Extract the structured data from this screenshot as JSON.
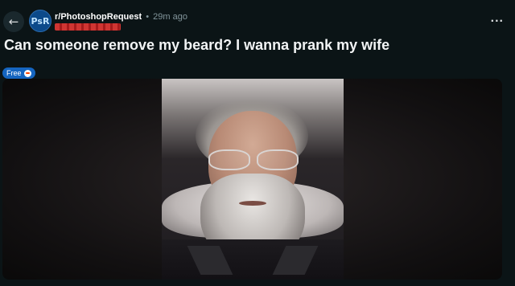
{
  "header": {
    "back_icon": "arrow-left-icon",
    "subreddit_icon_text": "PsR",
    "subreddit": "r/PhotoshopRequest",
    "separator": "•",
    "age": "29m ago",
    "more_label": "..."
  },
  "post": {
    "title": "Can someone remove my beard? I wanna prank my wife",
    "flair": "Free"
  },
  "colors": {
    "background": "#0b1416",
    "flair": "#1565c0",
    "subreddit_icon": "#0c4a8a",
    "redaction": "#e53935"
  }
}
